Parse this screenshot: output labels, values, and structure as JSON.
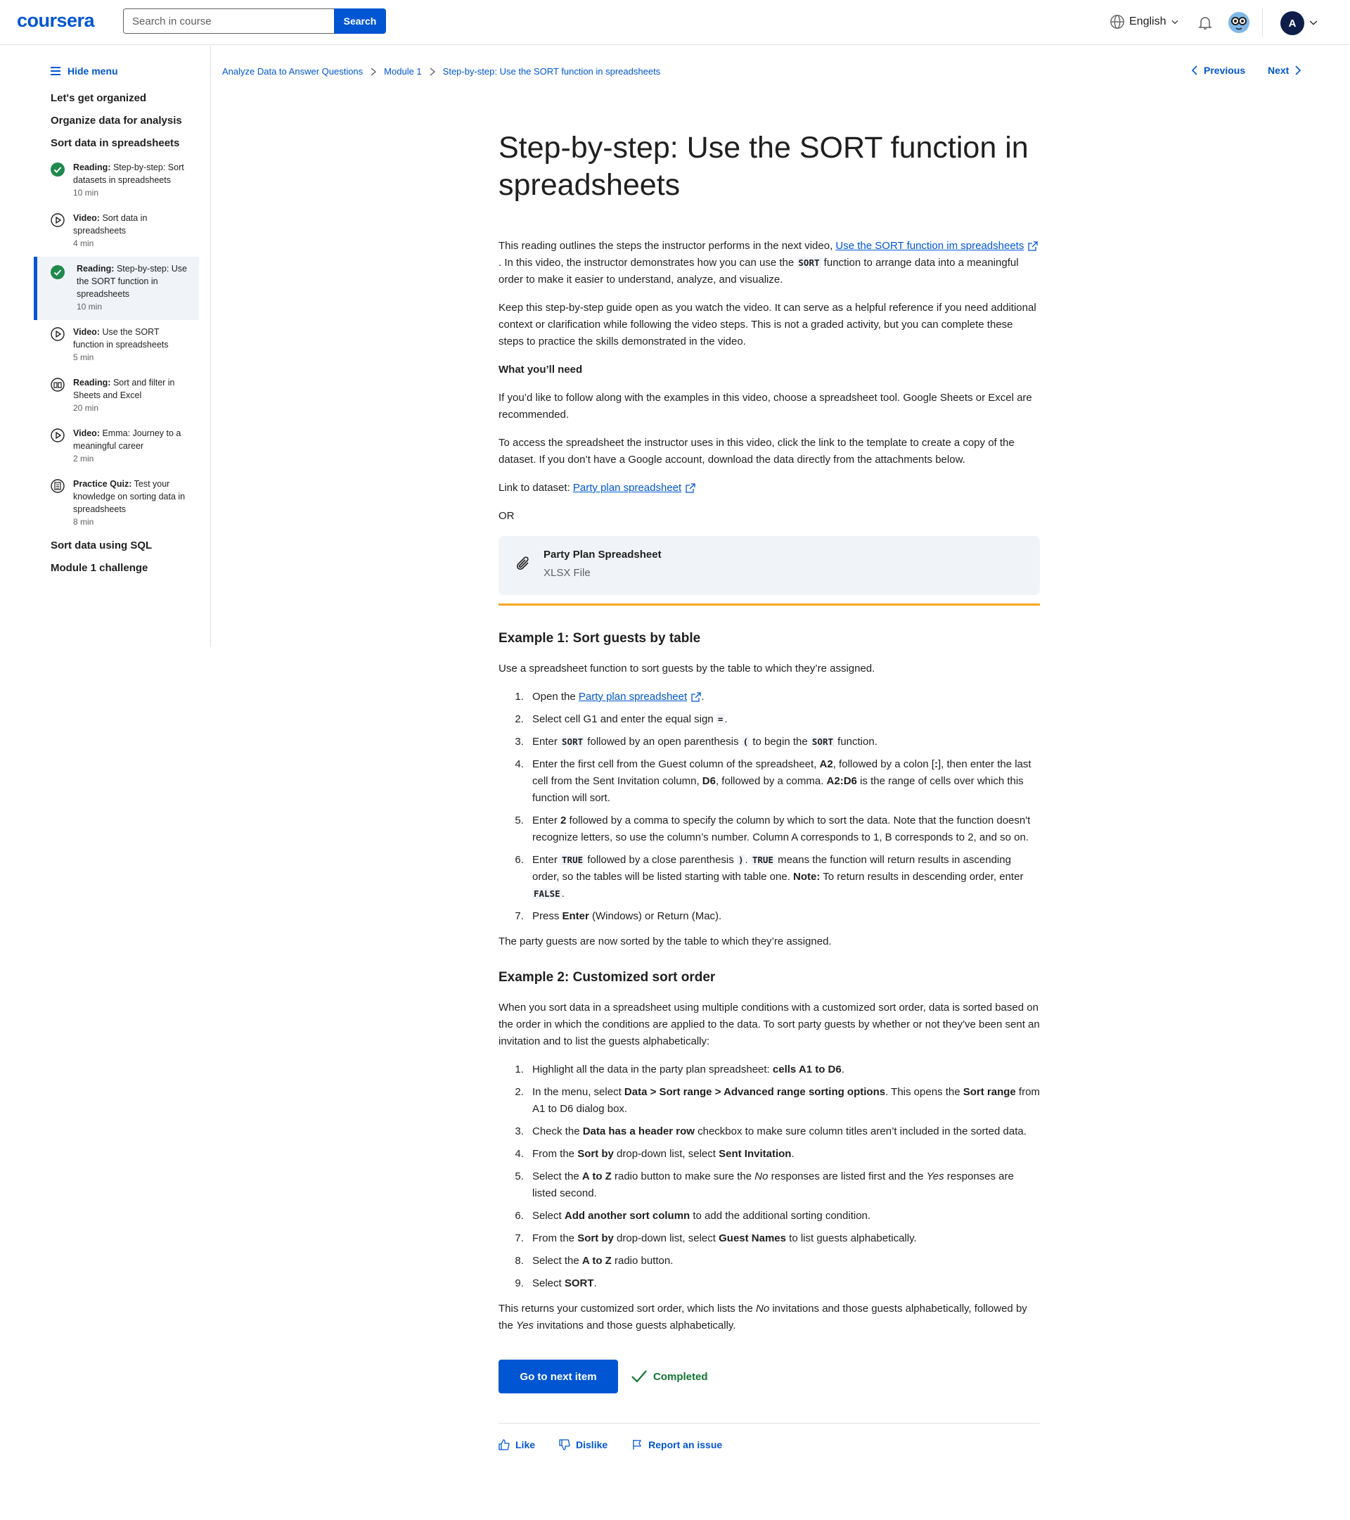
{
  "header": {
    "logo": "coursera",
    "search_placeholder": "Search in course",
    "search_button": "Search",
    "language": "English",
    "avatar_initial": "A"
  },
  "sidebar": {
    "hide_menu": "Hide menu",
    "sections": [
      "Let's get organized",
      "Organize data for analysis",
      "Sort data in spreadsheets"
    ],
    "items": [
      {
        "type": "Reading:",
        "title": "Step-by-step: Sort datasets in spreadsheets",
        "duration": "10 min",
        "status": "completed"
      },
      {
        "type": "Video:",
        "title": "Sort data in spreadsheets",
        "duration": "4 min",
        "status": "video"
      },
      {
        "type": "Reading:",
        "title": "Step-by-step: Use the SORT function in spreadsheets",
        "duration": "10 min",
        "status": "completed"
      },
      {
        "type": "Video:",
        "title": "Use the SORT function in spreadsheets",
        "duration": "5 min",
        "status": "video"
      },
      {
        "type": "Reading:",
        "title": "Sort and filter in Sheets and Excel",
        "duration": "20 min",
        "status": "reading"
      },
      {
        "type": "Video:",
        "title": "Emma: Journey to a meaningful career",
        "duration": "2 min",
        "status": "video"
      },
      {
        "type": "Practice Quiz:",
        "title": "Test your knowledge on sorting data in spreadsheets",
        "duration": "8 min",
        "status": "quiz"
      }
    ],
    "bottom_sections": [
      "Sort data using SQL",
      "Module 1 challenge"
    ]
  },
  "breadcrumb": [
    "Analyze Data to Answer Questions",
    "Module 1",
    "Step-by-step: Use the SORT function in spreadsheets"
  ],
  "nav": {
    "previous": "Previous",
    "next": "Next"
  },
  "article": {
    "title": "Step-by-step: Use the SORT function in spreadsheets",
    "intro_1a": "This reading outlines the steps the instructor performs in the next video, ",
    "intro_link": "Use the SORT function im spreadsheets",
    "intro_1b": ". In this video, the instructor demonstrates how you can use the ",
    "intro_code": "SORT",
    "intro_1c": " function to arrange data into a meaningful order to make it easier to understand, analyze, and visualize.",
    "intro_2": "Keep this step-by-step guide open as you watch the video. It can serve as a helpful reference if you need additional context or clarification while following the video steps. This is not a graded activity, but you can complete these steps to practice the skills demonstrated in the video.",
    "need_heading": "What you’ll need",
    "need_1": "If you’d like to follow along with the examples in this video, choose a spreadsheet tool. Google Sheets or Excel are recommended.",
    "need_2": "To access the spreadsheet the instructor uses in this video, click the link to the template to create a copy of the dataset. If you don’t have a Google account, download the data directly from the attachments below.",
    "dataset_label": "Link to dataset: ",
    "dataset_link": "Party plan spreadsheet",
    "or": "OR",
    "attachment_title": "Party Plan Spreadsheet",
    "attachment_type": "XLSX File",
    "ex1_heading": "Example 1: Sort guests by table",
    "ex1_intro": "Use a spreadsheet function to sort guests by the table to which they’re assigned.",
    "ex1_s1a": "Open the ",
    "ex1_s1_link": "Party plan spreadsheet",
    "ex1_s1b": ".",
    "ex1_s2a": "Select cell G1 and enter the equal sign ",
    "ex1_s2_code": "=",
    "ex1_s2b": ".",
    "ex1_s3a": "Enter ",
    "ex1_s3_code1": "SORT",
    "ex1_s3b": " followed by an open parenthesis ",
    "ex1_s3_code2": "(",
    "ex1_s3c": " to begin the ",
    "ex1_s3_code3": "SORT",
    "ex1_s3d": " function.",
    "ex1_s4a": "Enter the first cell from the Guest column of the spreadsheet, ",
    "ex1_s4_b1": "A2",
    "ex1_s4b": ", followed by a colon [",
    "ex1_s4_b2": ":",
    "ex1_s4c": "], then enter the last cell from the Sent Invitation column, ",
    "ex1_s4_b3": "D6",
    "ex1_s4d": ", followed by a comma. ",
    "ex1_s4_b4": "A2:D6",
    "ex1_s4e": " is the range of cells over which this function will sort.",
    "ex1_s5a": "Enter ",
    "ex1_s5_b": "2",
    "ex1_s5b": " followed by a comma to specify the column by which to sort the data. Note that the function doesn't recognize letters, so use the column’s number. Column A corresponds to 1, B corresponds to 2, and so on.",
    "ex1_s6a": "Enter ",
    "ex1_s6_code1": "TRUE",
    "ex1_s6b": " followed by a close parenthesis ",
    "ex1_s6_code2": ")",
    "ex1_s6c": ". ",
    "ex1_s6_code3": "TRUE",
    "ex1_s6d": " means the function will return results in ascending order, so the tables will be listed starting with table one. ",
    "ex1_s6_note": "Note:",
    "ex1_s6e": " To return results in descending order, enter ",
    "ex1_s6_code4": "FALSE",
    "ex1_s6f": ".",
    "ex1_s7a": "Press ",
    "ex1_s7_b": "Enter",
    "ex1_s7b": " (Windows) or Return (Mac).",
    "ex1_outro": "The party guests are now sorted by the table to which they’re assigned.",
    "ex2_heading": "Example 2: Customized sort order",
    "ex2_intro": "When you sort data in a spreadsheet using multiple conditions with a customized sort order, data is sorted  based on the order in which the conditions are applied to the data. To sort party guests by whether or not they've been sent an invitation and to list the guests alphabetically:",
    "ex2_s1a": "Highlight all the data in the party plan spreadsheet: ",
    "ex2_s1_b": "cells A1 to D6",
    "ex2_s1b": ".",
    "ex2_s2a": "In the menu, select ",
    "ex2_s2_b1": "Data > Sort range > Advanced range sorting options",
    "ex2_s2b": ". This opens the ",
    "ex2_s2_b2": "Sort range",
    "ex2_s2c": " from A1 to D6 dialog box.",
    "ex2_s3a": "Check the ",
    "ex2_s3_b": "Data has a header row",
    "ex2_s3b": " checkbox to make sure column titles aren’t included in the sorted data.",
    "ex2_s4a": "From the ",
    "ex2_s4_b1": "Sort by",
    "ex2_s4b": " drop-down list, select ",
    "ex2_s4_b2": "Sent Invitation",
    "ex2_s4c": ".",
    "ex2_s5a": "Select the ",
    "ex2_s5_b": "A to Z",
    "ex2_s5b": " radio button to make sure the ",
    "ex2_s5_i1": "No",
    "ex2_s5c": " responses are listed first and the ",
    "ex2_s5_i2": "Yes",
    "ex2_s5d": " responses are listed second.",
    "ex2_s6a": "Select ",
    "ex2_s6_b": "Add another sort column",
    "ex2_s6b": " to add the additional sorting condition.",
    "ex2_s7a": "From the ",
    "ex2_s7_b1": "Sort by",
    "ex2_s7b": " drop-down list, select ",
    "ex2_s7_b2": "Guest Names",
    "ex2_s7c": " to list guests alphabetically.",
    "ex2_s8a": "Select the ",
    "ex2_s8_b": "A to Z",
    "ex2_s8b": " radio button.",
    "ex2_s9a": "Select ",
    "ex2_s9_b": "SORT",
    "ex2_s9b": ".",
    "ex2_outro_a": "This returns your customized sort order, which lists the ",
    "ex2_outro_i1": "No",
    "ex2_outro_b": " invitations and those guests alphabetically, followed by the ",
    "ex2_outro_i2": "Yes",
    "ex2_outro_c": " invitations and those guests alphabetically.",
    "next_button": "Go to next item",
    "completed": "Completed",
    "like": "Like",
    "dislike": "Dislike",
    "report": "Report an issue"
  },
  "colors": {
    "primary": "#0056d2",
    "success": "#137333",
    "accent_rule": "#f5a623"
  }
}
